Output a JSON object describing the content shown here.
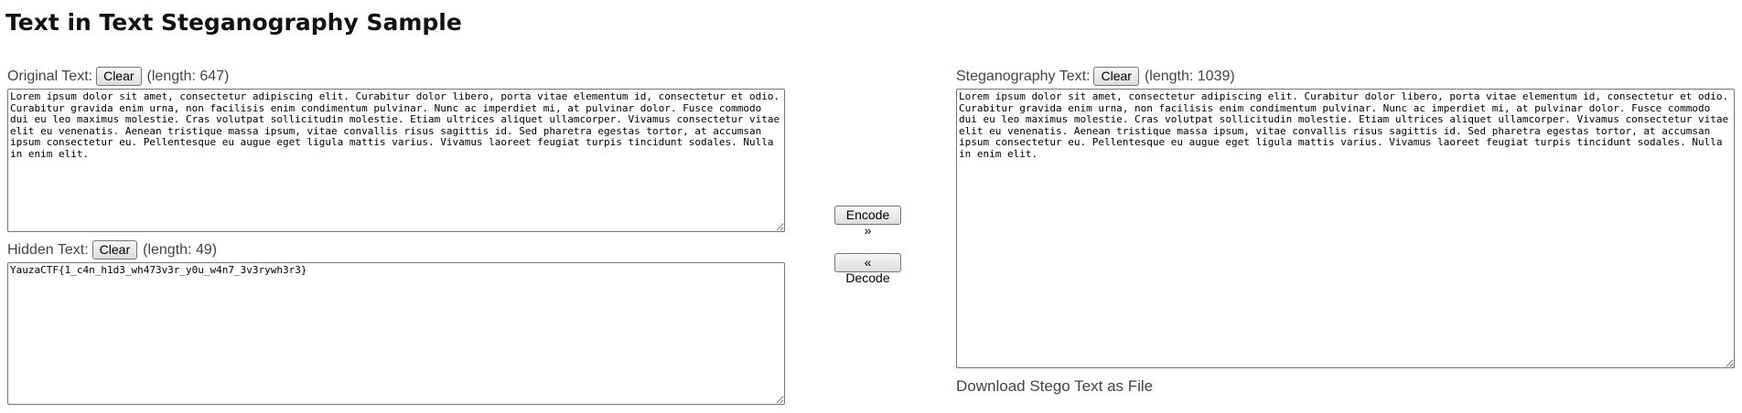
{
  "page": {
    "title": "Text in Text Steganography Sample"
  },
  "original": {
    "label": "Original Text:",
    "clear_label": "Clear",
    "length_label": "(length: 647)",
    "value": "Lorem ipsum dolor sit amet, consectetur adipiscing elit. Curabitur dolor libero, porta vitae elementum id, consectetur et odio. Curabitur gravida enim urna, non facilisis enim condimentum pulvinar. Nunc ac imperdiet mi, at pulvinar dolor. Fusce commodo dui eu leo maximus molestie. Cras volutpat sollicitudin molestie. Etiam ultrices aliquet ullamcorper. Vivamus consectetur vitae elit eu venenatis. Aenean tristique massa ipsum, vitae convallis risus sagittis id. Sed pharetra egestas tortor, at accumsan ipsum consectetur eu. Pellentesque eu augue eget ligula mattis varius. Vivamus laoreet feugiat turpis tincidunt sodales. Nulla in enim elit."
  },
  "hidden": {
    "label": "Hidden Text:",
    "clear_label": "Clear",
    "length_label": "(length: 49)",
    "value": "YauzaCTF{1_c4n_h1d3_wh473v3r_y0u_w4n7_3v3rywh3r3}"
  },
  "controls": {
    "encode_label": "Encode »",
    "decode_label": "« Decode"
  },
  "stego": {
    "label": "Steganography Text:",
    "clear_label": "Clear",
    "length_label": "(length: 1039)",
    "value": "Lorem ipsum dolor sit amet, consectetur adipiscing elit. Curabitur dolor libero, porta vitae elementum id, consectetur et odio. Curabitur gravida enim urna, non facilisis enim condimentum pulvinar. Nunc ac imperdiet mi, at pulvinar dolor. Fusce commodo dui eu leo maximus molestie. Cras volutpat sollicitudin molestie. Etiam ultrices aliquet ullamcorper. Vivamus consectetur vitae elit eu venenatis. Aenean tristique massa ipsum, vitae convallis risus sagittis id. Sed pharetra egestas tortor, at accumsan ipsum consectetur eu. Pellentesque eu augue eget ligula mattis varius. Vivamus laoreet feugiat turpis tincidunt sodales. Nulla in enim elit.",
    "download_label": "Download Stego Text as File"
  }
}
